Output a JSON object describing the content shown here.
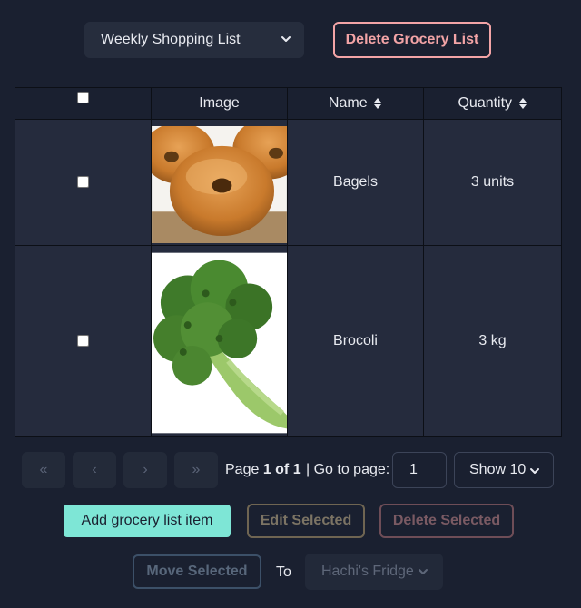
{
  "list_selector": {
    "value": "Weekly Shopping List",
    "icon": "chevron-down-icon"
  },
  "delete_list_button": "Delete Grocery List",
  "table": {
    "headers": {
      "image": "Image",
      "name": "Name",
      "quantity": "Quantity"
    },
    "rows": [
      {
        "name": "Bagels",
        "quantity": "3 units",
        "image": "bagel"
      },
      {
        "name": "Brocoli",
        "quantity": "3 kg",
        "image": "broccoli"
      }
    ]
  },
  "pagination": {
    "first": "«",
    "prev": "‹",
    "next": "›",
    "last": "»",
    "page_prefix": "Page ",
    "page_of": "1 of 1",
    "goto_label": " | Go to page:",
    "goto_value": "1",
    "show_value": "Show 10"
  },
  "actions": {
    "add": "Add grocery list item",
    "edit": "Edit Selected",
    "delete": "Delete Selected",
    "move": "Move Selected",
    "to": "To",
    "destination": "Hachi's Fridge"
  },
  "colors": {
    "background": "#1a2030",
    "row_background": "#252b3d",
    "accent_teal": "#7ee6d6",
    "danger_pink": "#f3a4a6"
  }
}
